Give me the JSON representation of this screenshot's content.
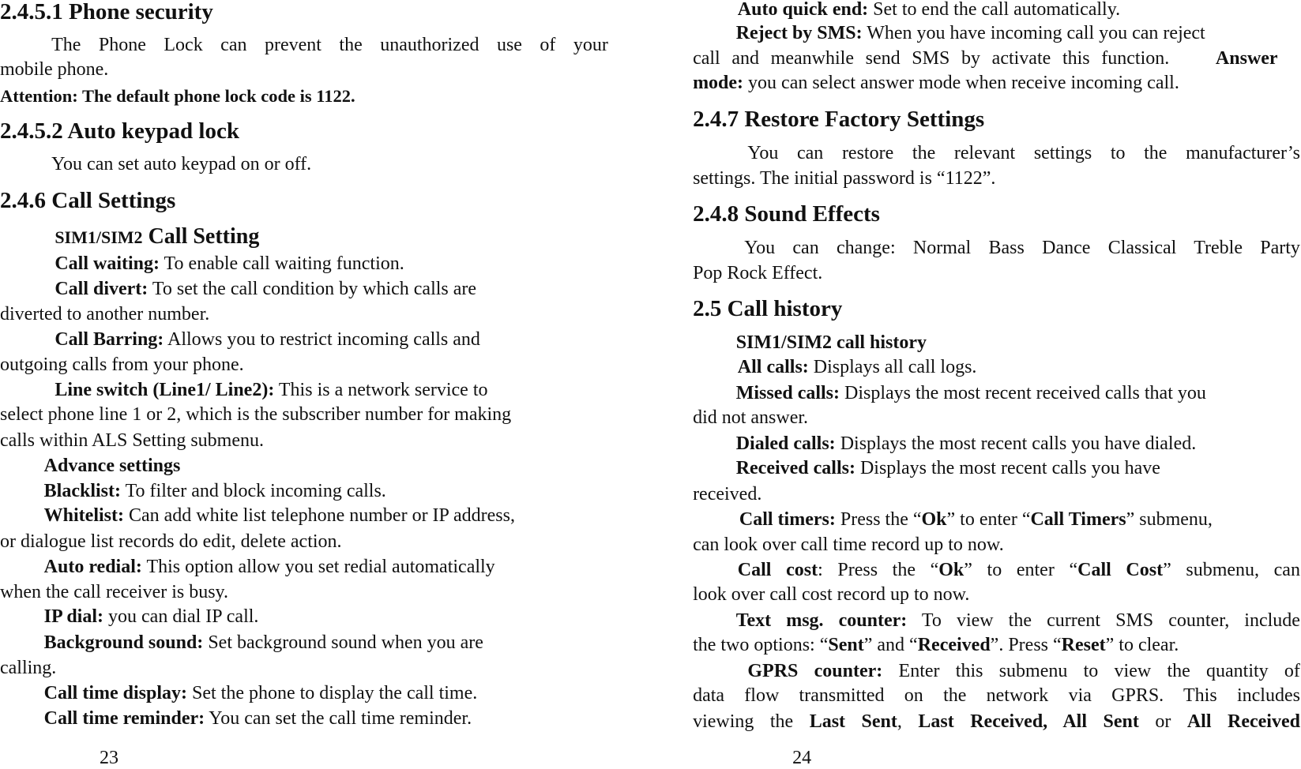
{
  "pages": [
    {
      "page_number": "23",
      "lines": [
        [
          {
            "t": "2.4.5.1 Phone security",
            "b": true
          }
        ],
        [
          {
            "t": "The Phone Lock can prevent the unauthorized use of your"
          }
        ],
        [
          {
            "t": "mobile phone."
          }
        ],
        [
          {
            "t": "Attention: The default phone lock code is 1122.",
            "b": true
          }
        ],
        [
          {
            "t": "2.4.5.2 Auto keypad lock",
            "b": true
          }
        ],
        [
          {
            "t": "You can set auto keypad on or off."
          }
        ],
        [
          {
            "t": "2.4.6 Call Settings",
            "b": true
          }
        ],
        [
          {
            "t": "SIM1/SIM2",
            "b": true,
            "s": "sm"
          },
          {
            "t": " Call Setting",
            "b": true,
            "s": "lg"
          }
        ],
        [
          {
            "t": "Call waiting:",
            "b": true
          },
          {
            "t": " To enable call waiting function."
          }
        ],
        [
          {
            "t": "Call divert:",
            "b": true
          },
          {
            "t": " To set the call condition by which calls are"
          }
        ],
        [
          {
            "t": "diverted to another number."
          }
        ],
        [
          {
            "t": "Call Barring:",
            "b": true
          },
          {
            "t": " Allows you to restrict incoming calls and"
          }
        ],
        [
          {
            "t": "outgoing calls from your phone."
          }
        ],
        [
          {
            "t": "Line switch (Line1/ Line2):",
            "b": true
          },
          {
            "t": " This is a network service to"
          }
        ],
        [
          {
            "t": "select phone line 1 or 2, which is the subscriber number for making"
          }
        ],
        [
          {
            "t": "calls within ALS Setting submenu."
          }
        ],
        [
          {
            "t": "Advance settings",
            "b": true
          }
        ],
        [
          {
            "t": "Blacklist:",
            "b": true
          },
          {
            "t": " To filter and block incoming calls."
          }
        ],
        [
          {
            "t": "Whitelist:",
            "b": true
          },
          {
            "t": " Can add white list telephone number or IP address,"
          }
        ],
        [
          {
            "t": "or dialogue list records do edit, delete action."
          }
        ],
        [
          {
            "t": "Auto redial:",
            "b": true
          },
          {
            "t": " This option allow you set redial automatically"
          }
        ],
        [
          {
            "t": "when the call receiver is busy."
          }
        ],
        [
          {
            "t": "IP dial:",
            "b": true
          },
          {
            "t": " you can dial IP call."
          }
        ],
        [
          {
            "t": "Background sound:",
            "b": true
          },
          {
            "t": " Set background sound when you are"
          }
        ],
        [
          {
            "t": "calling."
          }
        ],
        [
          {
            "t": "Call time display:",
            "b": true
          },
          {
            "t": " Set the phone to display the call time."
          }
        ],
        [
          {
            "t": "Call time reminder:",
            "b": true
          },
          {
            "t": " You can set the call time reminder."
          }
        ]
      ]
    },
    {
      "page_number": "24",
      "lines": [
        [
          {
            "t": "Auto quick end:",
            "b": true
          },
          {
            "t": " Set to end the call automatically."
          }
        ],
        [
          {
            "t": "Reject by SMS:",
            "b": true
          },
          {
            "t": " When you have incoming call you can reject"
          }
        ],
        [
          {
            "t": "call and meanwhile send SMS by activate this function.    "
          },
          {
            "t": "Answer",
            "b": true
          }
        ],
        [
          {
            "t": "mode:",
            "b": true
          },
          {
            "t": " you can select answer mode when receive incoming call."
          }
        ],
        [
          {
            "t": "2.4.7 Restore Factory Settings",
            "b": true
          }
        ],
        [
          {
            "t": "You can restore the relevant settings to the manufacturer’s"
          }
        ],
        [
          {
            "t": "settings. The initial password is “1122”."
          }
        ],
        [
          {
            "t": "2.4.8 Sound Effects",
            "b": true
          }
        ],
        [
          {
            "t": "You can change: Normal Bass Dance Classical Treble Party"
          }
        ],
        [
          {
            "t": "Pop Rock Effect."
          }
        ],
        [
          {
            "t": "2.5 Call history",
            "b": true
          }
        ],
        [
          {
            "t": "SIM1/SIM2 call history",
            "b": true
          }
        ],
        [
          {
            "t": "All calls:",
            "b": true
          },
          {
            "t": " Displays all call logs."
          }
        ],
        [
          {
            "t": "Missed calls:",
            "b": true
          },
          {
            "t": " Displays the most recent received calls that you"
          }
        ],
        [
          {
            "t": "did not answer."
          }
        ],
        [
          {
            "t": "Dialed calls:",
            "b": true
          },
          {
            "t": " Displays the most recent calls you have dialed."
          }
        ],
        [
          {
            "t": "Received calls:",
            "b": true
          },
          {
            "t": " Displays the most recent calls you have"
          }
        ],
        [
          {
            "t": "received."
          }
        ],
        [
          {
            "t": "Call timers:",
            "b": true
          },
          {
            "t": " Press the “"
          },
          {
            "t": "Ok",
            "b": true
          },
          {
            "t": "” to enter “"
          },
          {
            "t": "Call Timers",
            "b": true
          },
          {
            "t": "” submenu,"
          }
        ],
        [
          {
            "t": "can look over call time record up to now."
          }
        ],
        [
          {
            "t": "Call cost",
            "b": true
          },
          {
            "t": ": Press the “"
          },
          {
            "t": "Ok",
            "b": true
          },
          {
            "t": "” to enter “"
          },
          {
            "t": "Call Cost",
            "b": true
          },
          {
            "t": "” submenu, can"
          }
        ],
        [
          {
            "t": "look over call cost record up to now."
          }
        ],
        [
          {
            "t": "Text msg. counter:",
            "b": true
          },
          {
            "t": " To view the current SMS counter, include"
          }
        ],
        [
          {
            "t": "the two options: “"
          },
          {
            "t": "Sent",
            "b": true
          },
          {
            "t": "” and “"
          },
          {
            "t": "Received",
            "b": true
          },
          {
            "t": "”. Press “"
          },
          {
            "t": "Reset",
            "b": true
          },
          {
            "t": "” to clear."
          }
        ],
        [
          {
            "t": "GPRS counter:",
            "b": true
          },
          {
            "t": " Enter this submenu to view the quantity of"
          }
        ],
        [
          {
            "t": "data flow transmitted on the network via GPRS. This includes"
          }
        ],
        [
          {
            "t": "viewing the "
          },
          {
            "t": "Last Sent",
            "b": true
          },
          {
            "t": ", "
          },
          {
            "t": "Last Received, All Sent",
            "b": true
          },
          {
            "t": " or "
          },
          {
            "t": "All Received",
            "b": true
          }
        ]
      ]
    }
  ]
}
